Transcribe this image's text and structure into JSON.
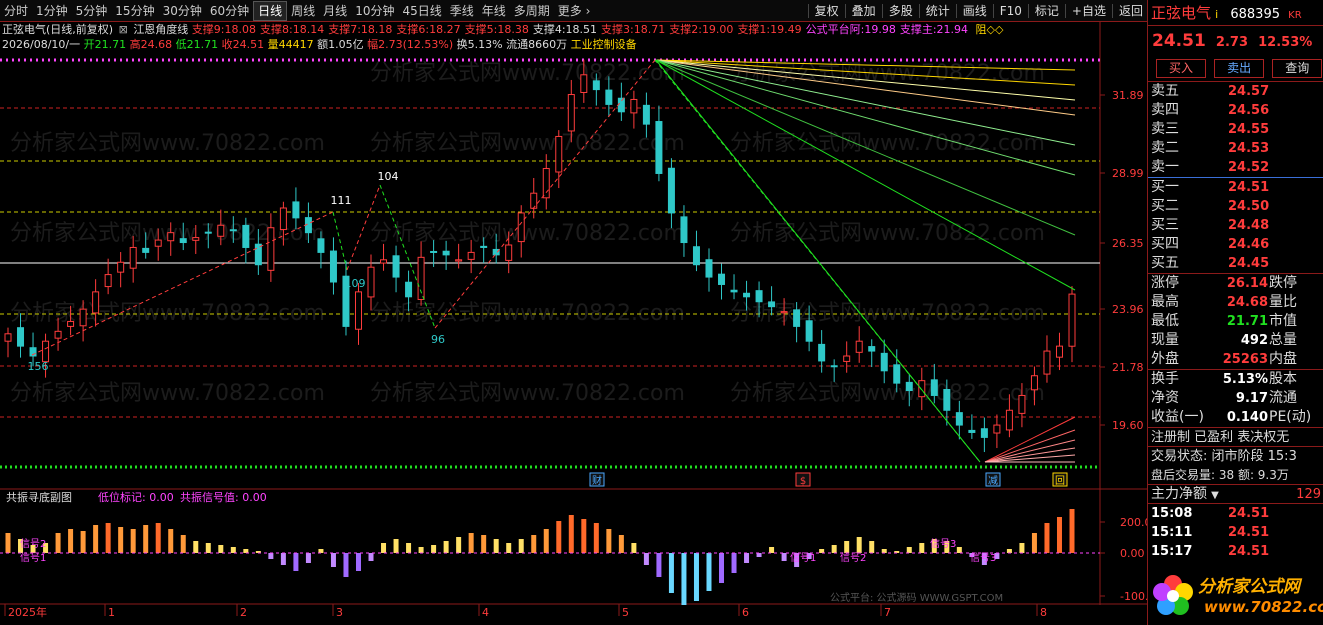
{
  "toolbar": {
    "periods": [
      "分时",
      "1分钟",
      "5分钟",
      "15分钟",
      "30分钟",
      "60分钟",
      "日线",
      "周线",
      "月线",
      "10分钟",
      "45日线",
      "季线",
      "年线",
      "多周期",
      "更多 ›"
    ],
    "active_index": 6,
    "right_items": [
      "复权",
      "叠加",
      "多股",
      "统计",
      "画线",
      "F10",
      "标记",
      "+自选",
      "返回"
    ]
  },
  "infobar1": {
    "title": "正弦电气(日线,前复权)",
    "indicator": "江恩角度线",
    "supports": [
      "支撑9:18.08",
      "支撑8:18.14",
      "支撑7:18.18",
      "支撑6:18.27",
      "支撑5:18.38",
      "支撑4:18.51",
      "支撑3:18.71",
      "支撑2:19.00",
      "支撑1:19.49",
      "公式平台阿:19.98",
      "支撑主:21.94"
    ],
    "tail": "阻◇◇"
  },
  "infobar2": {
    "date": "2026/08/10/一",
    "open": "开21.71",
    "high": "高24.68",
    "low": "低21.71",
    "close": "收24.51",
    "volume": "量44417",
    "amount": "额1.05亿",
    "change": "幅2.73(12.53%)",
    "turnover": "换5.13%",
    "float": "流通8660万",
    "sector": "工业控制设备"
  },
  "price_axis": [
    "31.89",
    "28.99",
    "26.35",
    "23.96",
    "21.78",
    "19.60"
  ],
  "peak_labels": [
    "156",
    "111",
    "104",
    "109",
    "96"
  ],
  "event_marks": [
    "财",
    "$",
    "减",
    "回"
  ],
  "sub_panel": {
    "title": "共振寻底副图",
    "low_mark": "低位标记: 0.00",
    "signal": "共振信号值: 0.00",
    "axis": [
      "200.0",
      "0.00",
      "-100.0"
    ],
    "signal_texts": [
      "信号2",
      "信号1",
      "信号1",
      "信号2",
      "信号3",
      "信号3"
    ]
  },
  "time_axis": [
    "2025年",
    "1",
    "2",
    "3",
    "4",
    "5",
    "6",
    "7",
    "8"
  ],
  "watermarks": [
    "分析家公式网www.70822.com",
    "公式平台: 公式源码 WWW.GSPT.COM"
  ],
  "quote": {
    "name": "正弦电气",
    "code": "688395",
    "flag": "KR",
    "price": "24.51",
    "change": "2.73",
    "change_pct": "12.53%",
    "buttons": [
      "买入",
      "卖出",
      "查询"
    ],
    "sell_levels": [
      {
        "label": "卖五",
        "price": "24.57"
      },
      {
        "label": "卖四",
        "price": "24.56"
      },
      {
        "label": "卖三",
        "price": "24.55"
      },
      {
        "label": "卖二",
        "price": "24.53"
      },
      {
        "label": "卖一",
        "price": "24.52"
      }
    ],
    "buy_levels": [
      {
        "label": "买一",
        "price": "24.51"
      },
      {
        "label": "买二",
        "price": "24.50"
      },
      {
        "label": "买三",
        "price": "24.48"
      },
      {
        "label": "买四",
        "price": "24.46"
      },
      {
        "label": "买五",
        "price": "24.45"
      }
    ],
    "stats": [
      {
        "k": "涨停",
        "v": "26.14",
        "k2": "跌停"
      },
      {
        "k": "最高",
        "v": "24.68",
        "k2": "量比"
      },
      {
        "k": "最低",
        "v": "21.71",
        "k2": "市值"
      },
      {
        "k": "现量",
        "v": "492",
        "k2": "总量"
      },
      {
        "k": "外盘",
        "v": "25263",
        "k2": "内盘"
      }
    ],
    "stats2": [
      {
        "k": "换手",
        "v": "5.13%",
        "k2": "股本"
      },
      {
        "k": "净资",
        "v": "9.17",
        "k2": "流通"
      },
      {
        "k": "收益(一)",
        "v": "0.140",
        "k2": "PE(动)"
      }
    ],
    "tags": "注册制 已盈利 表决权无",
    "trade_state": "交易状态: 闭市阶段 15:3",
    "after_hours": "盘后交易量: 38  额: 9.3万",
    "flow_title": "主力净额",
    "flow_value": "129",
    "ticks": [
      {
        "t": "15:08",
        "p": "24.51"
      },
      {
        "t": "15:11",
        "p": "24.51"
      },
      {
        "t": "15:17",
        "p": "24.51"
      }
    ]
  },
  "logo": {
    "name": "分析家公式网",
    "url": "www.70822.com"
  }
}
